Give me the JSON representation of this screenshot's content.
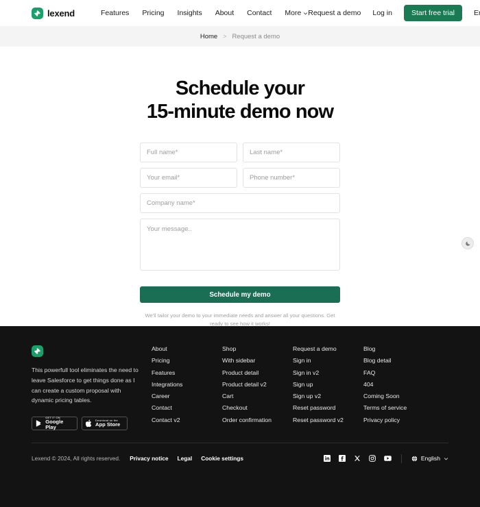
{
  "header": {
    "brand": {
      "name": "lexend",
      "icon": "plus-logo-icon"
    },
    "nav": [
      {
        "label": "Features",
        "has_caret": false
      },
      {
        "label": "Pricing",
        "has_caret": false
      },
      {
        "label": "Insights",
        "has_caret": false
      },
      {
        "label": "About",
        "has_caret": false
      },
      {
        "label": "Contact",
        "has_caret": false
      },
      {
        "label": "More",
        "has_caret": true
      }
    ],
    "request_demo": "Request a demo",
    "login": "Log in",
    "start_trial": "Start free trial",
    "language": "En",
    "accent_color": "#1a7a52"
  },
  "breadcrumb": {
    "home": "Home",
    "separator": ">",
    "current": "Request a demo"
  },
  "hero": {
    "title_line1": "Schedule your",
    "title_line2": "15-minute demo now"
  },
  "form": {
    "full_name_placeholder": "Full name*",
    "last_name_placeholder": "Last name*",
    "email_placeholder": "Your email*",
    "phone_placeholder": "Phone number*",
    "company_placeholder": "Company name*",
    "message_placeholder": "Your message..",
    "full_name_value": "",
    "last_name_value": "",
    "email_value": "",
    "phone_value": "",
    "company_value": "",
    "message_value": "",
    "submit_label": "Schedule my demo",
    "submit_color": "#1a6e53",
    "note": "We'll tailor your demo to your immediate needs and answer all your questions. Get ready to see how it works!"
  },
  "theme_toggle": {
    "icon": "moon-icon"
  },
  "footer": {
    "background": "#131313",
    "brand_icon": "plus-logo-icon",
    "description": "This powerfull tool eliminates the need to leave Salesforce to get things done as I can create a custom proposal with dynamic pricing tables.",
    "store_badges": [
      {
        "small": "GET IT ON",
        "large": "Google Play",
        "icon": "google-play-icon"
      },
      {
        "small": "Download on the",
        "large": "App Store",
        "icon": "apple-icon"
      }
    ],
    "columns": [
      {
        "links": [
          "About",
          "Pricing",
          "Features",
          "Integrations",
          "Career",
          "Contact",
          "Contact v2"
        ]
      },
      {
        "links": [
          "Shop",
          "With sidebar",
          "Product detail",
          "Product detail v2",
          "Cart",
          "Checkout",
          "Order confirmation"
        ]
      },
      {
        "links": [
          "Request a demo",
          "Sign in",
          "Sign in v2",
          "Sign up",
          "Sign up v2",
          "Reset password",
          "Reset password v2"
        ]
      },
      {
        "links": [
          "Blog",
          "Blog detail",
          "FAQ",
          "404",
          "Coming Soon",
          "Terms of service",
          "Privacy policy"
        ]
      }
    ],
    "copyright": "Lexend © 2024, All rights reserved.",
    "legal_links": [
      "Privacy notice",
      "Legal",
      "Cookie settings"
    ],
    "socials": [
      "linkedin-icon",
      "facebook-icon",
      "x-icon",
      "instagram-icon",
      "youtube-icon"
    ],
    "language": "English"
  }
}
